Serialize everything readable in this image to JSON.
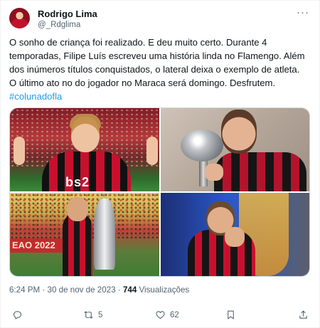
{
  "author": {
    "name": "Rodrigo Lima",
    "handle": "@_Rdglima"
  },
  "tweet": {
    "text": "O sonho de criança foi realizado. E deu muito certo. Durante 4 temporadas, Filipe Luís escreveu uma história linda no Flamengo. Além dos inúmeros títulos conquistados, o lateral deixa o exemplo de atleta.\nO último ato no do jogador no Maraca será domingo. Desfrutem.\n",
    "hashtag": "#colunadofla",
    "time": "6:24 PM",
    "separator": "·",
    "date": "30 de nov de 2023",
    "views_count": "744",
    "views_label": "Visualizações"
  },
  "media": {
    "photo1_text": "bs2",
    "photo3_text": "EAO 2022"
  },
  "actions": {
    "replies": "",
    "retweets": "5",
    "likes": "62"
  },
  "icons": [
    "more-icon",
    "reply-icon",
    "retweet-icon",
    "like-icon",
    "bookmark-icon",
    "share-icon"
  ],
  "colors": {
    "accent": "#1d9bf0",
    "text_secondary": "#536471"
  }
}
